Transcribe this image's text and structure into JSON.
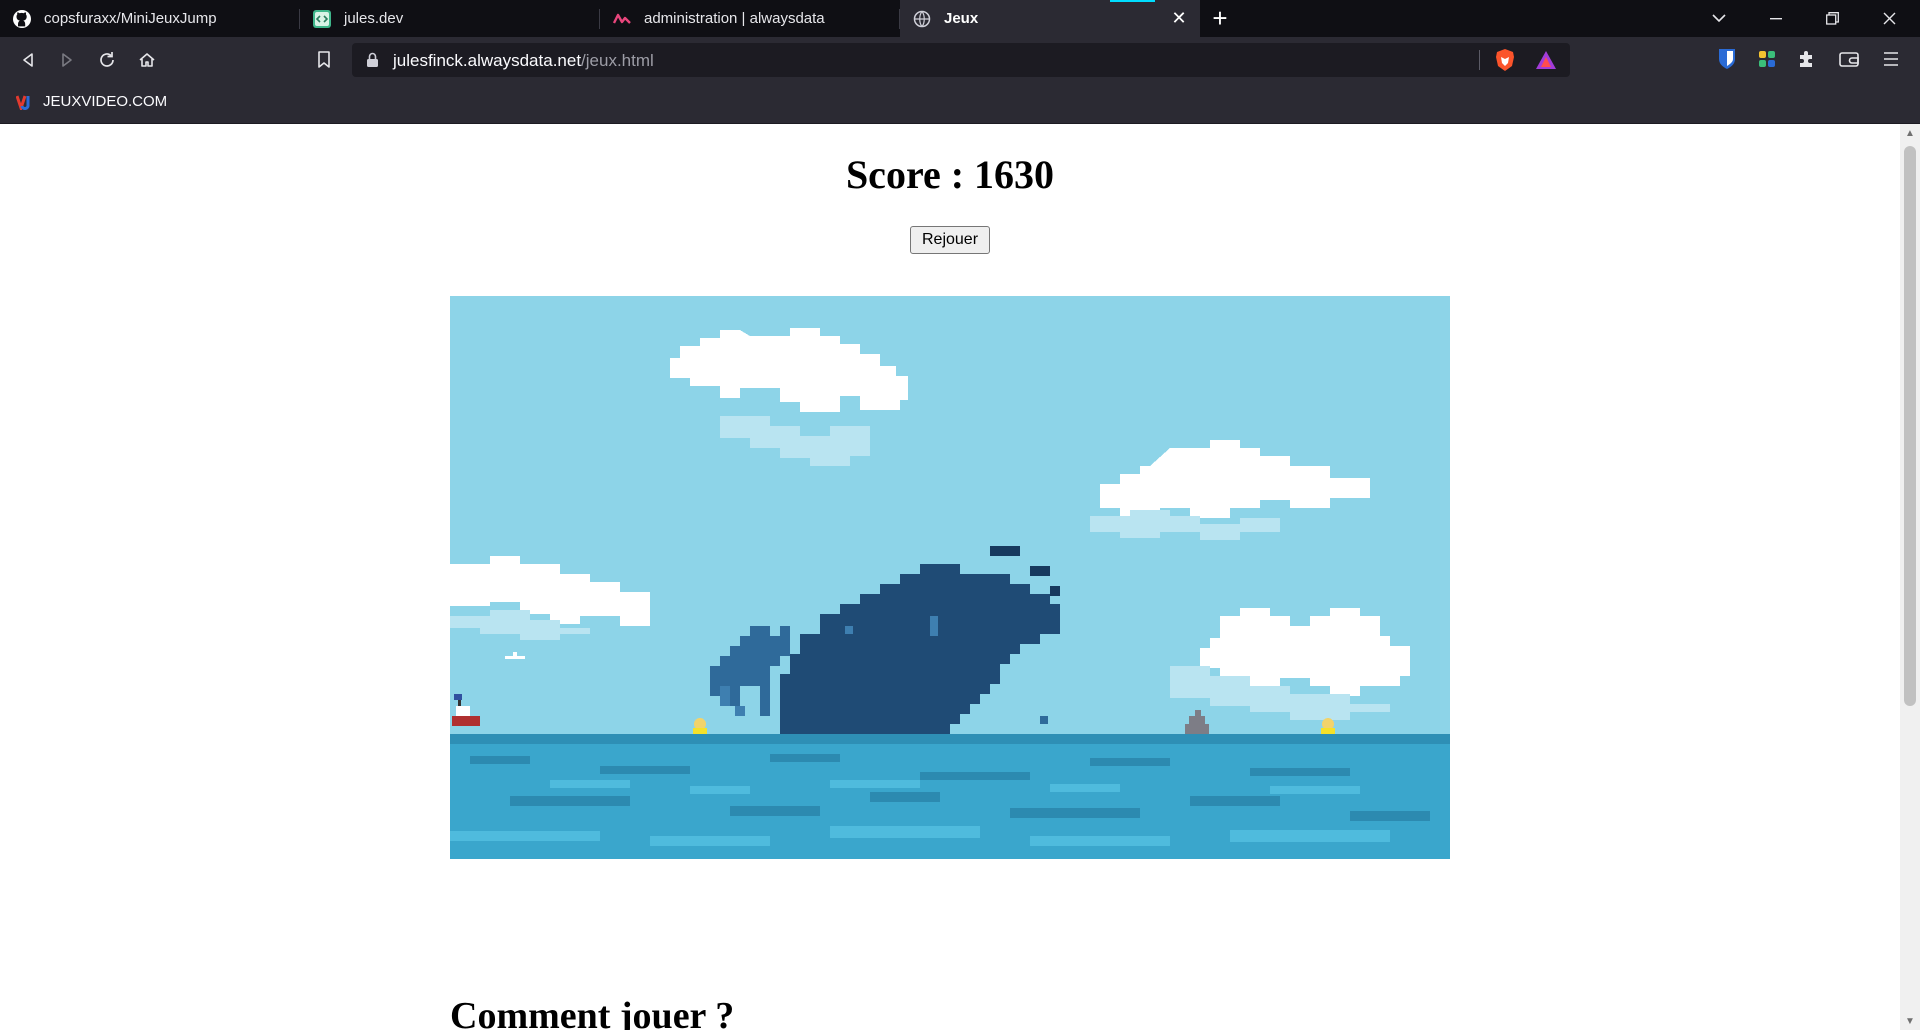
{
  "tabs": [
    {
      "title": "copsfuraxx/MiniJeuxJump",
      "icon": "github-icon",
      "active": false
    },
    {
      "title": "jules.dev",
      "icon": "code-file-icon",
      "active": false
    },
    {
      "title": "administration | alwaysdata",
      "icon": "alwaysdata-icon",
      "active": false
    },
    {
      "title": "Jeux",
      "icon": "globe-icon",
      "active": true
    }
  ],
  "address": {
    "host": "julesfinck.alwaysdata.net",
    "path": "/jeux.html"
  },
  "bookmarks": [
    {
      "label": "JEUXVIDEO.COM",
      "icon": "jeuxvideo-icon"
    }
  ],
  "page": {
    "score_text": "Score : 1630",
    "replay_label": "Rejouer",
    "section_heading": "Comment jouer ?"
  },
  "colors": {
    "sky": "#8dd4e8",
    "sea": "#3aa6cc",
    "whale": "#1f4b75",
    "chrome_dark": "#0f0f14",
    "chrome": "#2b2a33"
  }
}
